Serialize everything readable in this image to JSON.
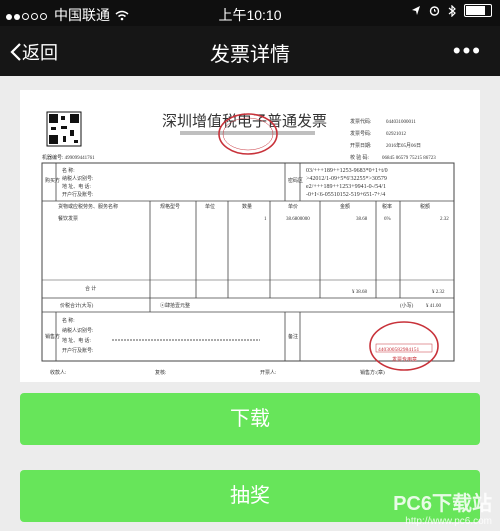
{
  "status": {
    "carrier": "中国联通",
    "time": "上午10:10"
  },
  "nav": {
    "back": "返回",
    "title": "发票详情",
    "more": "•••"
  },
  "invoice": {
    "title": "深圳增值税电子普通发票",
    "code_label": "发票代码:",
    "code": "044031000011",
    "number_label": "发票号码:",
    "number": "02921012",
    "date_label": "开票日期:",
    "date": "2016年05月06日",
    "check_label": "校 验 码:",
    "check": "06845 06579 75215 86723",
    "machine": "机器编号: 499099441761",
    "buyer_label": "购买方",
    "buyer_lines": [
      "名 称:",
      "纳税人识别号:",
      "地 址、电 话:",
      "开户行及账号:"
    ],
    "cipher_label": "密码区",
    "cipher": [
      "03/+++189++1253-9683*0+1+t/0",
      ">42012/1-09+5*6'32255*>30579",
      "e2/+++189++1253+9941-0-/54/1",
      "-0+I<6-05510152-519+651-7+/4"
    ],
    "headers": [
      "货物或应税劳务、服务名称",
      "规格型号",
      "单位",
      "数量",
      "单价",
      "金额",
      "税率",
      "税额"
    ],
    "item": "餐饮发票",
    "qty": "1",
    "price": "38.6800000",
    "amount": "38.68",
    "rate": "6%",
    "tax": "2.32",
    "total_label": "合 计",
    "total_amount": "¥ 38.68",
    "total_tax": "¥ 2.32",
    "sum_label": "价税合计(大写)",
    "sum_words": "ⓧ肆拾壹元整",
    "sum_small": "(小写)",
    "sum": "¥ 41.00",
    "seller_label": "销售方",
    "seller_lines": [
      "名 称:",
      "纳税人识别号:",
      "地 址、电 话:",
      "开户行及账号:"
    ],
    "remark_label": "备注",
    "footer": [
      "收款人:",
      "复核:",
      "开票人:",
      "销售方:(章)"
    ],
    "stamp_number": "440300582984151",
    "stamp_bottom": "发票专用章"
  },
  "buttons": {
    "download": "下载",
    "lottery": "抽奖"
  },
  "watermark": {
    "main": "PC6下载站",
    "sub": "http://www.pc6.com"
  }
}
